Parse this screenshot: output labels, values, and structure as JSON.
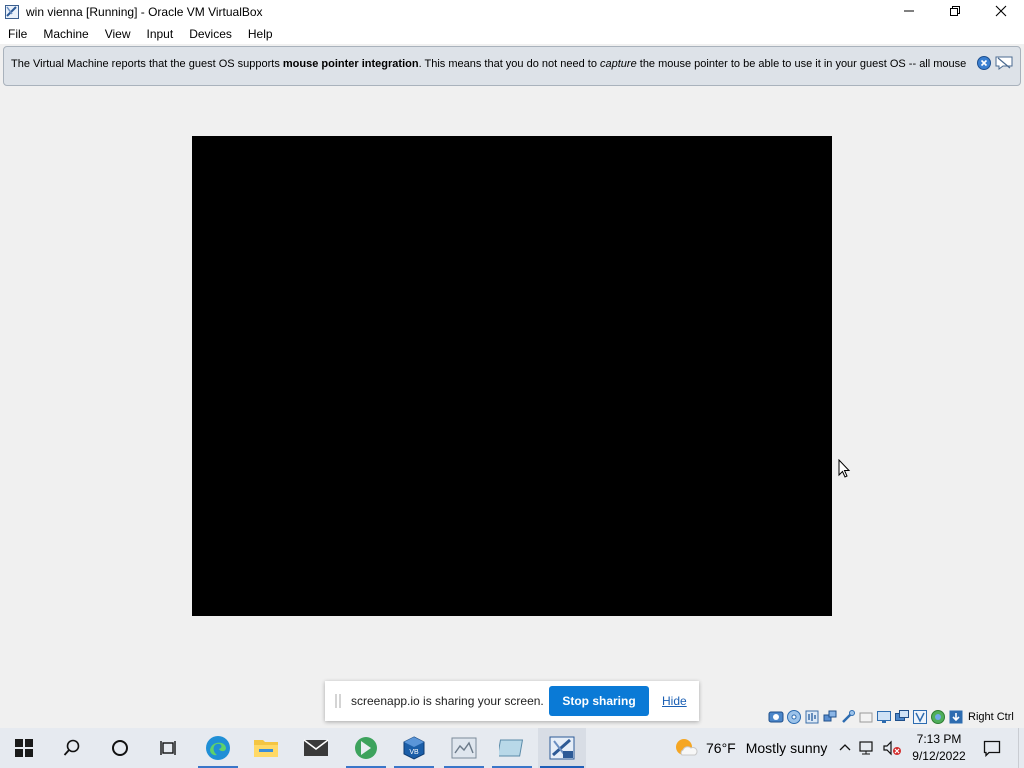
{
  "window": {
    "title": "win vienna [Running] - Oracle VM VirtualBox",
    "icon": "virtualbox-vm-icon"
  },
  "menubar": {
    "items": [
      "File",
      "Machine",
      "View",
      "Input",
      "Devices",
      "Help"
    ]
  },
  "notice": {
    "text_pre": "The Virtual Machine reports that the guest OS supports ",
    "text_bold": "mouse pointer integration",
    "text_mid": ". This means that you do not need to ",
    "text_italic": "capture",
    "text_post": " the mouse pointer to be able to use it in your guest OS -- all mouse"
  },
  "statusbar": {
    "icons": [
      "hard-disk-icon",
      "optical-drive-icon",
      "audio-icon",
      "network-icon",
      "usb-icon",
      "shared-folders-icon",
      "display-icon",
      "video-capture-icon",
      "recording-icon",
      "cpu-icon",
      "mouse-integration-icon",
      "keyboard-icon"
    ],
    "host_key": "Right Ctrl"
  },
  "share_bar": {
    "message": "screenapp.io is sharing your screen.",
    "stop_label": "Stop sharing",
    "hide_label": "Hide"
  },
  "taskbar": {
    "items": [
      "start",
      "search",
      "cortana",
      "task-view",
      "edge",
      "file-explorer",
      "mail",
      "internet-download-manager",
      "virtualbox",
      "app-1",
      "app-2",
      "virtualbox-vm"
    ],
    "weather_temp": "76°F",
    "weather_desc": "Mostly sunny",
    "time": "7:13 PM",
    "date": "9/12/2022"
  },
  "colors": {
    "accent": "#0a7ad6",
    "taskbar": "#e6eaf0",
    "notice_bg": "#dde2e8"
  }
}
